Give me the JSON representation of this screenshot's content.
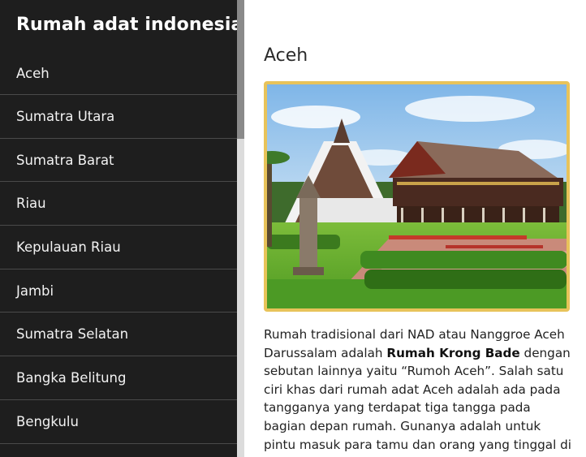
{
  "sidebar": {
    "title": "Rumah adat indonesia",
    "items": [
      {
        "label": "Aceh"
      },
      {
        "label": "Sumatra Utara"
      },
      {
        "label": "Sumatra Barat"
      },
      {
        "label": "Riau"
      },
      {
        "label": "Kepulauan Riau"
      },
      {
        "label": "Jambi"
      },
      {
        "label": "Sumatra Selatan"
      },
      {
        "label": "Bangka Belitung"
      },
      {
        "label": "Bengkulu"
      }
    ]
  },
  "main": {
    "title": "Aceh",
    "description": {
      "before": "Rumah tradisional dari NAD atau Nanggroe Aceh Darussalam adalah ",
      "bold": "Rumah Krong Bade",
      "after": " dengan sebutan lainnya yaitu “Rumoh Aceh”. Salah satu ciri khas dari rumah adat Aceh adalah ada pada tangganya yang terdapat tiga tangga pada bagian depan rumah. Gunanya adalah untuk pintu masuk para tamu dan orang yang tinggal di sana."
    }
  },
  "colors": {
    "sidebar_bg": "#1e1e1e",
    "frame_border": "#e8c35a",
    "text": "#222222"
  }
}
